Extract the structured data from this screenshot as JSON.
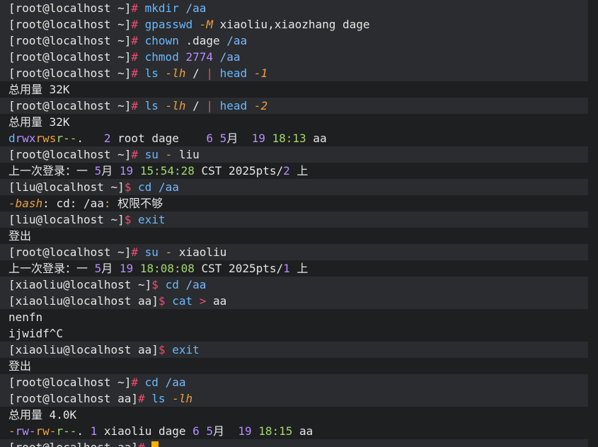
{
  "colors": {
    "background": "#1d1f21",
    "prompt_row_background": "#2a2c2f",
    "text": "#e6e6e6",
    "prompt_symbol": "#f24a6f",
    "command": "#6ab8ff",
    "option": "#f0a040",
    "path": "#7ab8ff",
    "number": "#b98cff",
    "time": "#a5d86c",
    "cursor": "#ffb000"
  },
  "lines": [
    {
      "prompt": true,
      "segments": [
        {
          "text": "[root@localhost ~]",
          "color": "text"
        },
        {
          "text": "# ",
          "color": "prompt_symbol"
        },
        {
          "text": "mkdir",
          "color": "command"
        },
        {
          "text": " ",
          "color": "text"
        },
        {
          "text": "/aa",
          "color": "path"
        }
      ]
    },
    {
      "prompt": true,
      "segments": [
        {
          "text": "[root@localhost ~]",
          "color": "text"
        },
        {
          "text": "# ",
          "color": "prompt_symbol"
        },
        {
          "text": "gpasswd",
          "color": "command"
        },
        {
          "text": " ",
          "color": "text"
        },
        {
          "text": "-M",
          "color": "option",
          "italic": true
        },
        {
          "text": " xiaoliu,xiaozhang dage",
          "color": "text"
        }
      ]
    },
    {
      "prompt": true,
      "segments": [
        {
          "text": "[root@localhost ~]",
          "color": "text"
        },
        {
          "text": "# ",
          "color": "prompt_symbol"
        },
        {
          "text": "chown",
          "color": "command"
        },
        {
          "text": " .dage ",
          "color": "text"
        },
        {
          "text": "/aa",
          "color": "path"
        }
      ]
    },
    {
      "prompt": true,
      "segments": [
        {
          "text": "[root@localhost ~]",
          "color": "text"
        },
        {
          "text": "# ",
          "color": "prompt_symbol"
        },
        {
          "text": "chmod",
          "color": "command"
        },
        {
          "text": " ",
          "color": "text"
        },
        {
          "text": "2774",
          "color": "number"
        },
        {
          "text": " ",
          "color": "text"
        },
        {
          "text": "/aa",
          "color": "path"
        }
      ]
    },
    {
      "prompt": true,
      "segments": [
        {
          "text": "[root@localhost ~]",
          "color": "text"
        },
        {
          "text": "# ",
          "color": "prompt_symbol"
        },
        {
          "text": "ls",
          "color": "command"
        },
        {
          "text": " ",
          "color": "text"
        },
        {
          "text": "-lh",
          "color": "option",
          "italic": true
        },
        {
          "text": " / ",
          "color": "text"
        },
        {
          "text": "| ",
          "color": "prompt_symbol"
        },
        {
          "text": "head",
          "color": "command"
        },
        {
          "text": " ",
          "color": "text"
        },
        {
          "text": "-1",
          "color": "option",
          "italic": true
        }
      ]
    },
    {
      "prompt": false,
      "segments": [
        {
          "text": "总用量 32K",
          "color": "text"
        }
      ]
    },
    {
      "prompt": true,
      "segments": [
        {
          "text": "[root@localhost ~]",
          "color": "text"
        },
        {
          "text": "# ",
          "color": "prompt_symbol"
        },
        {
          "text": "ls",
          "color": "command"
        },
        {
          "text": " ",
          "color": "text"
        },
        {
          "text": "-lh",
          "color": "option",
          "italic": true
        },
        {
          "text": " / ",
          "color": "text"
        },
        {
          "text": "| ",
          "color": "prompt_symbol"
        },
        {
          "text": "head",
          "color": "command"
        },
        {
          "text": " ",
          "color": "text"
        },
        {
          "text": "-2",
          "color": "option",
          "italic": true
        }
      ]
    },
    {
      "prompt": false,
      "segments": [
        {
          "text": "总用量 32K",
          "color": "text"
        }
      ]
    },
    {
      "prompt": false,
      "segments": [
        {
          "text": "d",
          "color": "command"
        },
        {
          "text": "rwx",
          "color": "number"
        },
        {
          "text": "rws",
          "color": "option"
        },
        {
          "text": "r--",
          "color": "time"
        },
        {
          "text": ".   ",
          "color": "text"
        },
        {
          "text": "2",
          "color": "number"
        },
        {
          "text": " root dage    ",
          "color": "text"
        },
        {
          "text": "6",
          "color": "number"
        },
        {
          "text": " ",
          "color": "text"
        },
        {
          "text": "5",
          "color": "number"
        },
        {
          "text": "月  ",
          "color": "text"
        },
        {
          "text": "19",
          "color": "number"
        },
        {
          "text": " ",
          "color": "text"
        },
        {
          "text": "18:13",
          "color": "time"
        },
        {
          "text": " aa",
          "color": "text"
        }
      ]
    },
    {
      "prompt": true,
      "segments": [
        {
          "text": "[root@localhost ~]",
          "color": "text"
        },
        {
          "text": "# ",
          "color": "prompt_symbol"
        },
        {
          "text": "su",
          "color": "command"
        },
        {
          "text": " ",
          "color": "text"
        },
        {
          "text": "-",
          "color": "option"
        },
        {
          "text": " liu",
          "color": "text"
        }
      ]
    },
    {
      "prompt": false,
      "segments": [
        {
          "text": "上一次登录：一 ",
          "color": "text"
        },
        {
          "text": "5",
          "color": "number"
        },
        {
          "text": "月 ",
          "color": "text"
        },
        {
          "text": "19",
          "color": "number"
        },
        {
          "text": " ",
          "color": "text"
        },
        {
          "text": "15:54:28",
          "color": "time"
        },
        {
          "text": " CST 2025pts/",
          "color": "text"
        },
        {
          "text": "2",
          "color": "number"
        },
        {
          "text": " 上",
          "color": "text"
        }
      ]
    },
    {
      "prompt": true,
      "segments": [
        {
          "text": "[liu@localhost ~]",
          "color": "text"
        },
        {
          "text": "$ ",
          "color": "prompt_symbol"
        },
        {
          "text": "cd",
          "color": "command"
        },
        {
          "text": " ",
          "color": "text"
        },
        {
          "text": "/aa",
          "color": "path"
        }
      ]
    },
    {
      "prompt": false,
      "segments": [
        {
          "text": "-bash",
          "color": "option",
          "italic": true
        },
        {
          "text": ": cd: /aa",
          "color": "text"
        },
        {
          "text": ":",
          "color": "option"
        },
        {
          "text": " 权限不够",
          "color": "text"
        }
      ]
    },
    {
      "prompt": true,
      "segments": [
        {
          "text": "[liu@localhost ~]",
          "color": "text"
        },
        {
          "text": "$ ",
          "color": "prompt_symbol"
        },
        {
          "text": "exit",
          "color": "command"
        }
      ]
    },
    {
      "prompt": false,
      "segments": [
        {
          "text": "登出",
          "color": "text"
        }
      ]
    },
    {
      "prompt": true,
      "segments": [
        {
          "text": "[root@localhost ~]",
          "color": "text"
        },
        {
          "text": "# ",
          "color": "prompt_symbol"
        },
        {
          "text": "su",
          "color": "command"
        },
        {
          "text": " ",
          "color": "text"
        },
        {
          "text": "-",
          "color": "option"
        },
        {
          "text": " xiaoliu",
          "color": "text"
        }
      ]
    },
    {
      "prompt": false,
      "segments": [
        {
          "text": "上一次登录：一 ",
          "color": "text"
        },
        {
          "text": "5",
          "color": "number"
        },
        {
          "text": "月 ",
          "color": "text"
        },
        {
          "text": "19",
          "color": "number"
        },
        {
          "text": " ",
          "color": "text"
        },
        {
          "text": "18:08:08",
          "color": "time"
        },
        {
          "text": " CST 2025pts/",
          "color": "text"
        },
        {
          "text": "1",
          "color": "number"
        },
        {
          "text": " 上",
          "color": "text"
        }
      ]
    },
    {
      "prompt": true,
      "segments": [
        {
          "text": "[xiaoliu@localhost ~]",
          "color": "text"
        },
        {
          "text": "$ ",
          "color": "prompt_symbol"
        },
        {
          "text": "cd",
          "color": "command"
        },
        {
          "text": " ",
          "color": "text"
        },
        {
          "text": "/aa",
          "color": "path"
        }
      ]
    },
    {
      "prompt": true,
      "segments": [
        {
          "text": "[xiaoliu@localhost aa]",
          "color": "text"
        },
        {
          "text": "$ ",
          "color": "prompt_symbol"
        },
        {
          "text": "cat",
          "color": "command"
        },
        {
          "text": " ",
          "color": "text"
        },
        {
          "text": ">",
          "color": "prompt_symbol"
        },
        {
          "text": " aa",
          "color": "text"
        }
      ]
    },
    {
      "prompt": false,
      "segments": [
        {
          "text": "nenfn",
          "color": "text"
        }
      ]
    },
    {
      "prompt": false,
      "segments": [
        {
          "text": "ijwidf^C",
          "color": "text"
        }
      ]
    },
    {
      "prompt": true,
      "segments": [
        {
          "text": "[xiaoliu@localhost aa]",
          "color": "text"
        },
        {
          "text": "$ ",
          "color": "prompt_symbol"
        },
        {
          "text": "exit",
          "color": "command"
        }
      ]
    },
    {
      "prompt": false,
      "segments": [
        {
          "text": "登出",
          "color": "text"
        }
      ]
    },
    {
      "prompt": true,
      "segments": [
        {
          "text": "[root@localhost ~]",
          "color": "text"
        },
        {
          "text": "# ",
          "color": "prompt_symbol"
        },
        {
          "text": "cd",
          "color": "command"
        },
        {
          "text": " ",
          "color": "text"
        },
        {
          "text": "/aa",
          "color": "path"
        }
      ]
    },
    {
      "prompt": true,
      "segments": [
        {
          "text": "[root@localhost aa]",
          "color": "text"
        },
        {
          "text": "# ",
          "color": "prompt_symbol"
        },
        {
          "text": "ls",
          "color": "command"
        },
        {
          "text": " ",
          "color": "text"
        },
        {
          "text": "-lh",
          "color": "option",
          "italic": true
        }
      ]
    },
    {
      "prompt": false,
      "segments": [
        {
          "text": "总用量 4.0K",
          "color": "text"
        }
      ]
    },
    {
      "prompt": false,
      "segments": [
        {
          "text": "-",
          "color": "option"
        },
        {
          "text": "rw-",
          "color": "number"
        },
        {
          "text": "rw-",
          "color": "option"
        },
        {
          "text": "r--",
          "color": "time"
        },
        {
          "text": ". ",
          "color": "text"
        },
        {
          "text": "1",
          "color": "number"
        },
        {
          "text": " xiaoliu dage ",
          "color": "text"
        },
        {
          "text": "6",
          "color": "number"
        },
        {
          "text": " ",
          "color": "text"
        },
        {
          "text": "5",
          "color": "number"
        },
        {
          "text": "月  ",
          "color": "text"
        },
        {
          "text": "19",
          "color": "number"
        },
        {
          "text": " ",
          "color": "text"
        },
        {
          "text": "18:15",
          "color": "time"
        },
        {
          "text": " aa",
          "color": "text"
        }
      ]
    },
    {
      "prompt": true,
      "cursor": true,
      "segments": [
        {
          "text": "[root@localhost aa]",
          "color": "text"
        },
        {
          "text": "# ",
          "color": "prompt_symbol"
        }
      ]
    }
  ]
}
